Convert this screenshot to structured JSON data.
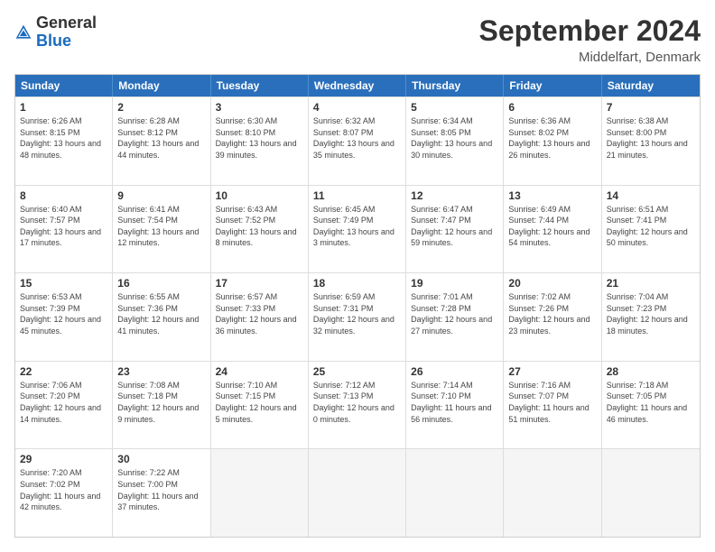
{
  "logo": {
    "general": "General",
    "blue": "Blue"
  },
  "title": "September 2024",
  "subtitle": "Middelfart, Denmark",
  "headers": [
    "Sunday",
    "Monday",
    "Tuesday",
    "Wednesday",
    "Thursday",
    "Friday",
    "Saturday"
  ],
  "weeks": [
    [
      {
        "day": "1",
        "sunrise": "6:26 AM",
        "sunset": "8:15 PM",
        "daylight": "13 hours and 48 minutes."
      },
      {
        "day": "2",
        "sunrise": "6:28 AM",
        "sunset": "8:12 PM",
        "daylight": "13 hours and 44 minutes."
      },
      {
        "day": "3",
        "sunrise": "6:30 AM",
        "sunset": "8:10 PM",
        "daylight": "13 hours and 39 minutes."
      },
      {
        "day": "4",
        "sunrise": "6:32 AM",
        "sunset": "8:07 PM",
        "daylight": "13 hours and 35 minutes."
      },
      {
        "day": "5",
        "sunrise": "6:34 AM",
        "sunset": "8:05 PM",
        "daylight": "13 hours and 30 minutes."
      },
      {
        "day": "6",
        "sunrise": "6:36 AM",
        "sunset": "8:02 PM",
        "daylight": "13 hours and 26 minutes."
      },
      {
        "day": "7",
        "sunrise": "6:38 AM",
        "sunset": "8:00 PM",
        "daylight": "13 hours and 21 minutes."
      }
    ],
    [
      {
        "day": "8",
        "sunrise": "6:40 AM",
        "sunset": "7:57 PM",
        "daylight": "13 hours and 17 minutes."
      },
      {
        "day": "9",
        "sunrise": "6:41 AM",
        "sunset": "7:54 PM",
        "daylight": "13 hours and 12 minutes."
      },
      {
        "day": "10",
        "sunrise": "6:43 AM",
        "sunset": "7:52 PM",
        "daylight": "13 hours and 8 minutes."
      },
      {
        "day": "11",
        "sunrise": "6:45 AM",
        "sunset": "7:49 PM",
        "daylight": "13 hours and 3 minutes."
      },
      {
        "day": "12",
        "sunrise": "6:47 AM",
        "sunset": "7:47 PM",
        "daylight": "12 hours and 59 minutes."
      },
      {
        "day": "13",
        "sunrise": "6:49 AM",
        "sunset": "7:44 PM",
        "daylight": "12 hours and 54 minutes."
      },
      {
        "day": "14",
        "sunrise": "6:51 AM",
        "sunset": "7:41 PM",
        "daylight": "12 hours and 50 minutes."
      }
    ],
    [
      {
        "day": "15",
        "sunrise": "6:53 AM",
        "sunset": "7:39 PM",
        "daylight": "12 hours and 45 minutes."
      },
      {
        "day": "16",
        "sunrise": "6:55 AM",
        "sunset": "7:36 PM",
        "daylight": "12 hours and 41 minutes."
      },
      {
        "day": "17",
        "sunrise": "6:57 AM",
        "sunset": "7:33 PM",
        "daylight": "12 hours and 36 minutes."
      },
      {
        "day": "18",
        "sunrise": "6:59 AM",
        "sunset": "7:31 PM",
        "daylight": "12 hours and 32 minutes."
      },
      {
        "day": "19",
        "sunrise": "7:01 AM",
        "sunset": "7:28 PM",
        "daylight": "12 hours and 27 minutes."
      },
      {
        "day": "20",
        "sunrise": "7:02 AM",
        "sunset": "7:26 PM",
        "daylight": "12 hours and 23 minutes."
      },
      {
        "day": "21",
        "sunrise": "7:04 AM",
        "sunset": "7:23 PM",
        "daylight": "12 hours and 18 minutes."
      }
    ],
    [
      {
        "day": "22",
        "sunrise": "7:06 AM",
        "sunset": "7:20 PM",
        "daylight": "12 hours and 14 minutes."
      },
      {
        "day": "23",
        "sunrise": "7:08 AM",
        "sunset": "7:18 PM",
        "daylight": "12 hours and 9 minutes."
      },
      {
        "day": "24",
        "sunrise": "7:10 AM",
        "sunset": "7:15 PM",
        "daylight": "12 hours and 5 minutes."
      },
      {
        "day": "25",
        "sunrise": "7:12 AM",
        "sunset": "7:13 PM",
        "daylight": "12 hours and 0 minutes."
      },
      {
        "day": "26",
        "sunrise": "7:14 AM",
        "sunset": "7:10 PM",
        "daylight": "11 hours and 56 minutes."
      },
      {
        "day": "27",
        "sunrise": "7:16 AM",
        "sunset": "7:07 PM",
        "daylight": "11 hours and 51 minutes."
      },
      {
        "day": "28",
        "sunrise": "7:18 AM",
        "sunset": "7:05 PM",
        "daylight": "11 hours and 46 minutes."
      }
    ],
    [
      {
        "day": "29",
        "sunrise": "7:20 AM",
        "sunset": "7:02 PM",
        "daylight": "11 hours and 42 minutes."
      },
      {
        "day": "30",
        "sunrise": "7:22 AM",
        "sunset": "7:00 PM",
        "daylight": "11 hours and 37 minutes."
      },
      null,
      null,
      null,
      null,
      null
    ]
  ]
}
